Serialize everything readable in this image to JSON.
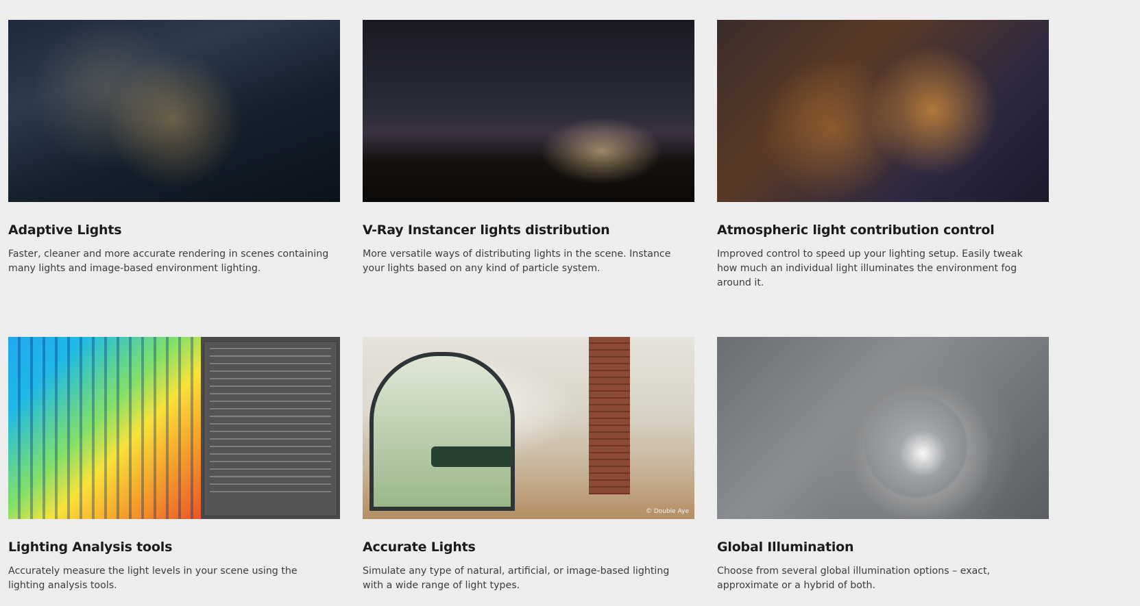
{
  "cards": [
    {
      "title": "Adaptive Lights",
      "description": "Faster, cleaner and more accurate rendering in scenes containing many lights and image-based environment lighting."
    },
    {
      "title": "V-Ray Instancer lights distribution",
      "description": "More versatile ways of distributing lights in the scene. Instance your lights based on any kind of particle system."
    },
    {
      "title": "Atmospheric light contribution control",
      "description": "Improved control to speed up your lighting setup. Easily tweak how much an individual light illuminates the environment fog around it."
    },
    {
      "title": "Lighting Analysis tools",
      "description": "Accurately measure the light levels in your scene using the lighting analysis tools."
    },
    {
      "title": "Accurate Lights",
      "description": "Simulate any type of natural, artificial, or image-based lighting with a wide range of light types.",
      "image_credit": "© Double Aye"
    },
    {
      "title": "Global Illumination",
      "description": "Choose from several global illumination options – exact, approximate or a hybrid of both."
    }
  ]
}
